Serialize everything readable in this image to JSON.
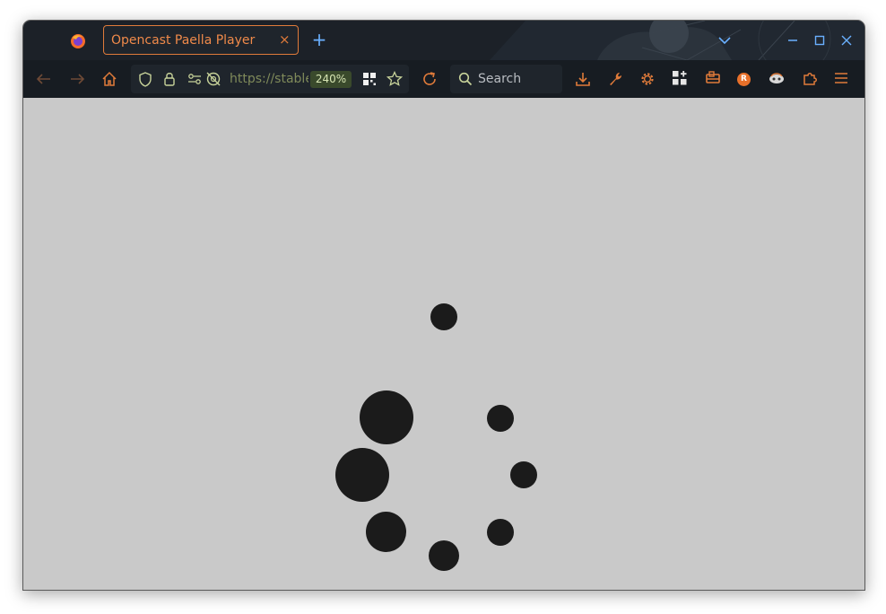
{
  "browser": {
    "tab_title": "Opencast Paella Player",
    "tab_close_glyph": "×",
    "new_tab_glyph": "+",
    "url": "https://stable.opencast.org/paella/ui/watch.html",
    "zoom": "240%",
    "search_label": "Search",
    "profile_initial": "R",
    "accent_color": "#e07b3a",
    "icons": {
      "back": "back-arrow-icon",
      "forward": "forward-arrow-icon",
      "home": "home-icon",
      "shield": "tracking-protection-shield-icon",
      "lock": "lock-icon",
      "permissions": "permissions-icon",
      "no_tracking": "tracking-blocked-icon",
      "qr": "qr-code-icon",
      "bookmark": "bookmark-star-icon",
      "reload": "reload-icon",
      "search": "search-icon",
      "downloads": "download-icon",
      "devtools": "wrench-icon",
      "settings": "gear-icon",
      "extensions_grid": "add-extension-icon",
      "container": "container-icon",
      "profile": "profile-avatar-icon",
      "addon": "addon-icon",
      "puzzle": "extensions-puzzle-icon",
      "menu": "hamburger-menu-icon"
    }
  },
  "page": {
    "state": "loading",
    "background_color": "#c9c9c9",
    "spinner_color": "#1b1b1b"
  }
}
